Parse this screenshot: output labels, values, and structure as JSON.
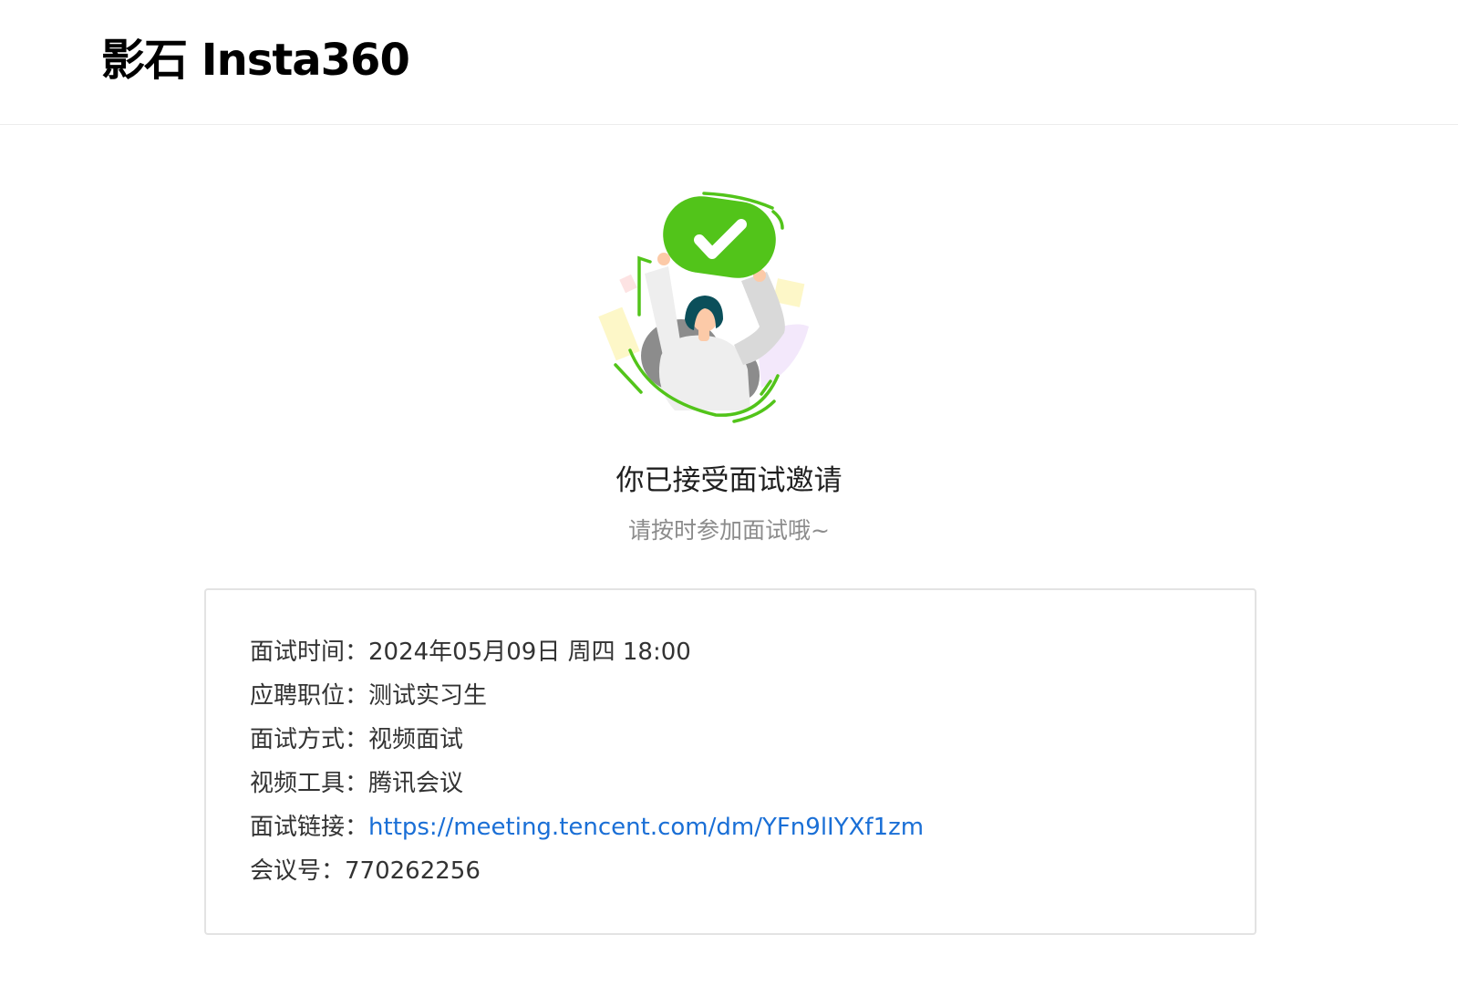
{
  "header": {
    "brand": "影石 Insta360"
  },
  "hero": {
    "title": "你已接受面试邀请",
    "subtitle": "请按时参加面试哦~"
  },
  "details": [
    {
      "label": "面试时间：",
      "value": "2024年05月09日 周四 18:00"
    },
    {
      "label": "应聘职位：",
      "value": "测试实习生"
    },
    {
      "label": "面试方式：",
      "value": "视频面试"
    },
    {
      "label": "视频工具：",
      "value": "腾讯会议"
    },
    {
      "label": "面试链接：",
      "value": "https://meeting.tencent.com/dm/YFn9lIYXf1zm"
    },
    {
      "label": "会议号：",
      "value": "770262256"
    }
  ],
  "colors": {
    "accent_green": "#52c41a",
    "link_blue": "#1a6fd6",
    "muted_text": "#8c8c8c"
  }
}
